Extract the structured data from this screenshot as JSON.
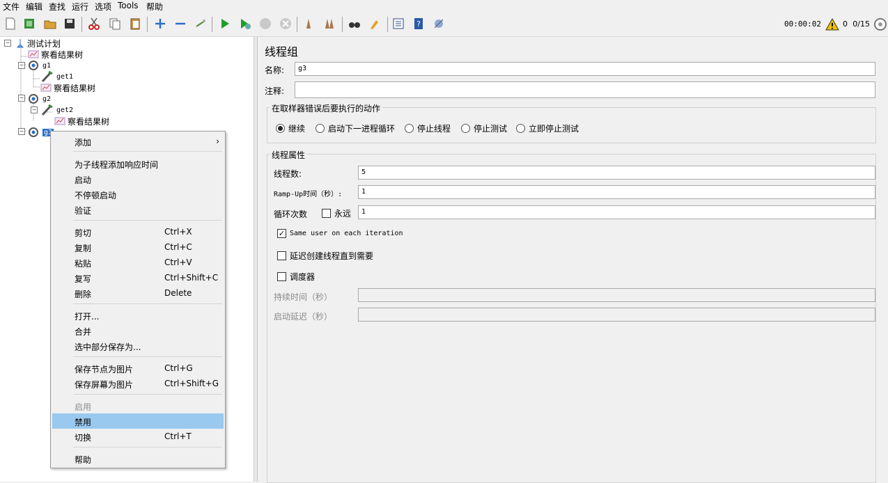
{
  "menu": [
    "文件",
    "编辑",
    "查找",
    "运行",
    "选项",
    "Tools",
    "帮助"
  ],
  "toolbar": {
    "icons": [
      "new-icon",
      "templates-icon",
      "open-icon",
      "save-icon",
      "cut-icon",
      "copy-icon",
      "paste-icon",
      "expand-icon",
      "collapse-icon",
      "toggle-icon",
      "start-icon",
      "start-no-pause-icon",
      "stop-icon",
      "shutdown-icon",
      "clear-icon",
      "clear-all-icon",
      "search-icon",
      "reset-search-icon",
      "function-helper-icon",
      "help-icon",
      "remote-icon"
    ],
    "timer": "00:00:02",
    "warnings": "0",
    "threads": "0/15"
  },
  "tree": {
    "root": "测试计划",
    "items": [
      {
        "label": "察看结果树"
      },
      {
        "label": "g1"
      },
      {
        "label": "get1"
      },
      {
        "label": "察看结果树"
      },
      {
        "label": "g2"
      },
      {
        "label": "get2"
      },
      {
        "label": "察看结果树"
      },
      {
        "label": "g3"
      }
    ]
  },
  "context_menu": {
    "add": "添加",
    "add_response_time": "为子线程添加响应时间",
    "start": "启动",
    "start_no_pause": "不停顿启动",
    "validate": "验证",
    "cut": "剪切",
    "cut_key": "Ctrl+X",
    "copy": "复制",
    "copy_key": "Ctrl+C",
    "paste": "粘贴",
    "paste_key": "Ctrl+V",
    "duplicate": "复写",
    "duplicate_key": "Ctrl+Shift+C",
    "delete": "删除",
    "delete_key": "Delete",
    "open": "打开...",
    "merge": "合并",
    "save_selection": "选中部分保存为...",
    "save_node_image": "保存节点为图片",
    "save_node_image_key": "Ctrl+G",
    "save_screen_image": "保存屏幕为图片",
    "save_screen_image_key": "Ctrl+Shift+G",
    "enable": "启用",
    "disable": "禁用",
    "toggle": "切换",
    "toggle_key": "Ctrl+T",
    "help": "帮助"
  },
  "panel": {
    "title": "线程组",
    "name_label": "名称:",
    "name_value": "g3",
    "comment_label": "注释:",
    "comment_value": "",
    "error_action_title": "在取样器错误后要执行的动作",
    "error_actions": [
      "继续",
      "启动下一进程循环",
      "停止线程",
      "停止测试",
      "立即停止测试"
    ],
    "thread_props_title": "线程属性",
    "threads_label": "线程数:",
    "threads_value": "5",
    "rampup_label": "Ramp-Up时间（秒）:",
    "rampup_value": "1",
    "loop_label": "循环次数",
    "forever_label": "永远",
    "loop_value": "1",
    "same_user_label": "Same user on each iteration",
    "delay_create_label": "延迟创建线程直到需要",
    "scheduler_label": "调度器",
    "duration_label": "持续时间（秒）",
    "startup_delay_label": "启动延迟（秒）"
  }
}
